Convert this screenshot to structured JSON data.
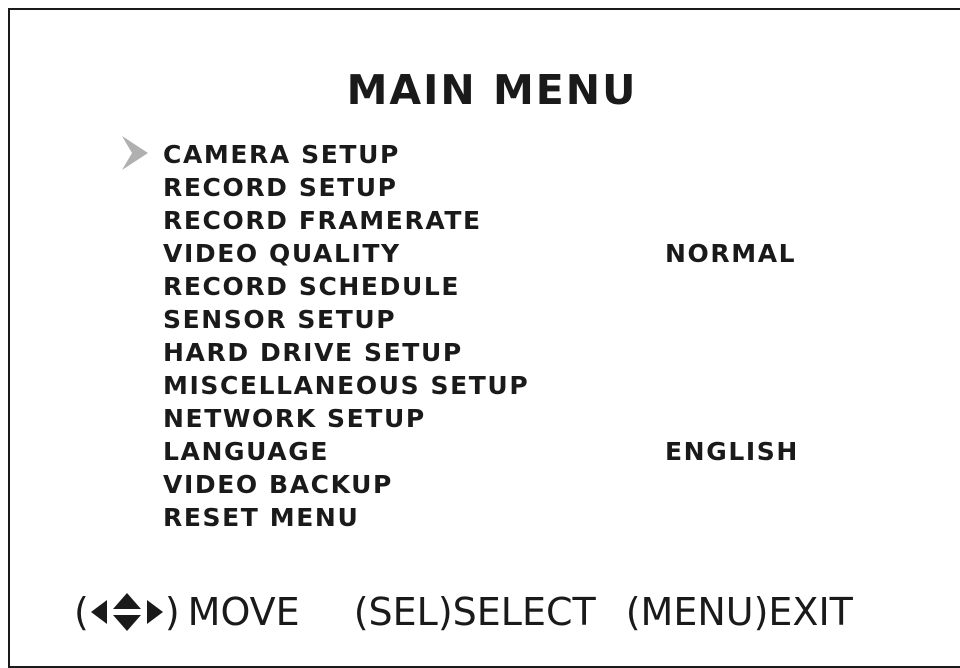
{
  "title": "MAIN MENU",
  "menu": {
    "items": [
      {
        "label": "CAMERA SETUP",
        "value": ""
      },
      {
        "label": "RECORD SETUP",
        "value": ""
      },
      {
        "label": "RECORD FRAMERATE",
        "value": ""
      },
      {
        "label": "VIDEO QUALITY",
        "value": "NORMAL"
      },
      {
        "label": "RECORD SCHEDULE",
        "value": ""
      },
      {
        "label": "SENSOR SETUP",
        "value": ""
      },
      {
        "label": "HARD DRIVE SETUP",
        "value": ""
      },
      {
        "label": "MISCELLANEOUS SETUP",
        "value": ""
      },
      {
        "label": "NETWORK SETUP",
        "value": ""
      },
      {
        "label": "LANGUAGE",
        "value": "ENGLISH"
      },
      {
        "label": "VIDEO BACKUP",
        "value": ""
      },
      {
        "label": "RESET MENU",
        "value": ""
      }
    ],
    "selected_index": 0,
    "pointer_icon": "chevron-right-icon"
  },
  "footer": {
    "move": {
      "open": "(",
      "icon": "four-way-arrows-icon",
      "close": ")",
      "label": "MOVE"
    },
    "select": {
      "key": "(SEL)",
      "label": "SELECT"
    },
    "exit": {
      "key": "(MENU)",
      "label": "EXIT"
    }
  },
  "colors": {
    "text": "#1a1a1a",
    "pointer": "#b0b0b0",
    "background": "#ffffff"
  }
}
